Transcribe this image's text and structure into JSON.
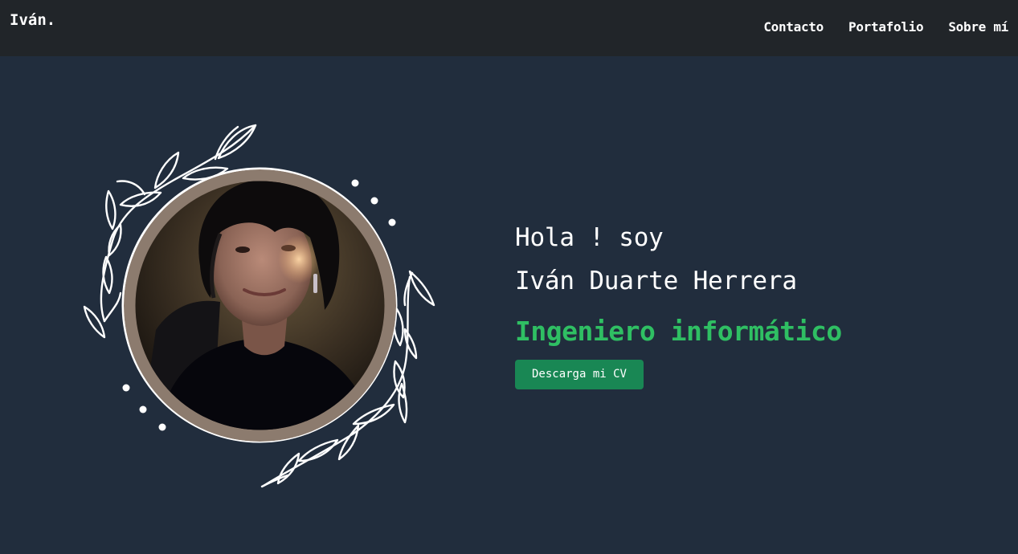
{
  "navbar": {
    "brand": "Iván.",
    "links": [
      {
        "label": "Contacto"
      },
      {
        "label": "Portafolio"
      },
      {
        "label": "Sobre mí"
      }
    ]
  },
  "hero": {
    "greeting": "Hola ! soy",
    "name": "Iván Duarte Herrera",
    "role": "Ingeniero informático",
    "cv_button": "Descarga mi CV",
    "profile_photo": "profile-photo",
    "decoration": "leaf-wreath"
  },
  "colors": {
    "navbar_bg": "#212529",
    "page_bg": "#212d3d",
    "accent_green": "#2fbf63",
    "button_bg": "#198754",
    "photo_ring": "#8c7b6e"
  }
}
